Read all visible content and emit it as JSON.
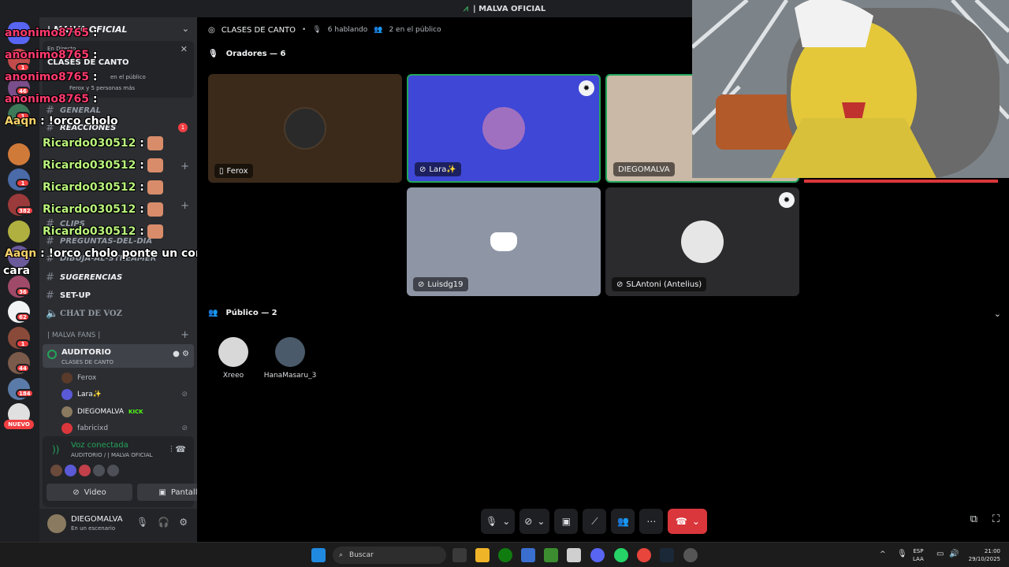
{
  "window": {
    "title": "| MALVA OFICIAL"
  },
  "server_rail": {
    "badges": [
      "1",
      "46",
      "1",
      "1",
      "2",
      "382",
      "1",
      "36",
      "62",
      "1",
      "44",
      "184"
    ],
    "nuevo_label": "NUEVO"
  },
  "sidebar": {
    "server_name": "| MALVA OFICIAL",
    "live_card": {
      "status": "En Directo",
      "channel_name": "CLASES DE CANTO",
      "stats": "en el público",
      "people": "Ferox y 5 personas más"
    },
    "channels": [
      {
        "name": "GENERAL",
        "badge": ""
      },
      {
        "name": "REACCIONES",
        "badge": "1"
      },
      {
        "name": "CLIPS",
        "badge": ""
      },
      {
        "name": "PREGUNTAS-DEL-DIA",
        "badge": ""
      },
      {
        "name": "DIBUJA-AL-STREAMER",
        "badge": ""
      },
      {
        "name": "SUGERENCIAS",
        "badge": ""
      },
      {
        "name": "SET-UP",
        "badge": ""
      },
      {
        "name": "CHAT DE VOZ",
        "badge": ""
      }
    ],
    "category_fans": "| MALVA FANS |",
    "voice_channel": {
      "name": "AUDITORIO",
      "subtitle": "CLASES DE CANTO"
    },
    "voice_users": [
      {
        "name": "Ferox",
        "tag": ""
      },
      {
        "name": "Lara✨",
        "tag": ""
      },
      {
        "name": "DIEGOMALVA",
        "tag": "KICK"
      },
      {
        "name": "fabricixd",
        "tag": ""
      }
    ],
    "voice_connected": {
      "status": "Voz conectada",
      "location": "AUDITORIO / | MALVA OFICIAL",
      "video_label": "Video",
      "screen_label": "Pantalla"
    },
    "user": {
      "name": "DIEGOMALVA",
      "status": "En un escenario"
    }
  },
  "chat_overlay": [
    {
      "name": "anonimo8765",
      "color": "red",
      "message": ":"
    },
    {
      "name": "anonimo8765",
      "color": "red",
      "message": ":"
    },
    {
      "name": "anonimo8765",
      "color": "red",
      "message": ":"
    },
    {
      "name": "anonimo8765",
      "color": "red",
      "message": ":"
    },
    {
      "name": "Aaqn",
      "color": "yellow",
      "message": ": !orco cholo"
    },
    {
      "name": "Ricardo030512",
      "color": "green",
      "message": ":"
    },
    {
      "name": "Ricardo030512",
      "color": "green",
      "message": ":"
    },
    {
      "name": "Ricardo030512",
      "color": "green",
      "message": ":"
    },
    {
      "name": "Ricardo030512",
      "color": "green",
      "message": ":"
    },
    {
      "name": "Ricardo030512",
      "color": "green",
      "message": ":"
    },
    {
      "name": "Aaqn",
      "color": "yellow",
      "message": ": !orco cholo ponte un condon en tu"
    },
    {
      "name": "",
      "color": "yellow",
      "message": "cara"
    }
  ],
  "stage": {
    "channel": "CLASES DE CANTO",
    "speaking": "6 hablando",
    "audience": "2 en el público",
    "speakers_heading": "Oradores — 6",
    "speakers": [
      {
        "name": "Ferox",
        "bg": "#3b2a1a",
        "badge": false
      },
      {
        "name": "Lara✨",
        "bg": "#3f47d6",
        "badge": true
      },
      {
        "name": "DIEGOMALVA",
        "bg": "#c9b9a6",
        "badge": false
      },
      {
        "name": "Luisdg19",
        "bg": "#8e96a6",
        "badge": false
      },
      {
        "name": "SLAntoni (Antelius)",
        "bg": "#2b2b2e",
        "badge": true
      }
    ],
    "audience_heading": "Público — 2",
    "audience_members": [
      "Xreeo",
      "HanaMasaru_3"
    ]
  },
  "taskbar": {
    "search_placeholder": "Buscar",
    "lang_top": "ESP",
    "lang_bottom": "LAA",
    "time": "21:00",
    "date": "29/10/2025"
  },
  "colors": {
    "discord_bg": "#2b2d31",
    "rail_bg": "#1e1f22",
    "green": "#23a55a",
    "red": "#da373c",
    "blurple": "#3f47d6"
  }
}
